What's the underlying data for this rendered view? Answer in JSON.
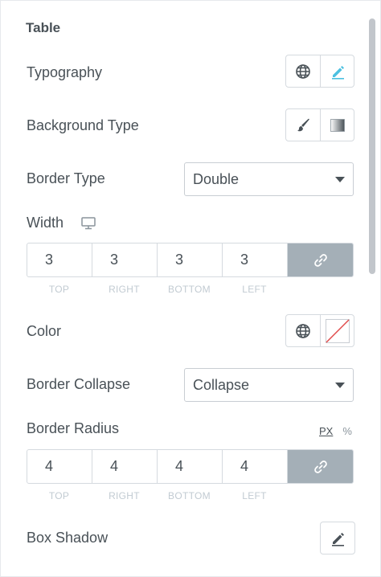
{
  "section": {
    "title": "Table"
  },
  "typography": {
    "label": "Typography",
    "icons": [
      "globe-icon",
      "pencil-icon"
    ],
    "active_color": "#4cc0e0"
  },
  "background_type": {
    "label": "Background Type",
    "icons": [
      "brush-icon",
      "gradient-icon"
    ]
  },
  "border_type": {
    "label": "Border Type",
    "value": "Double"
  },
  "width": {
    "label": "Width",
    "device_icon": "desktop-icon",
    "values": {
      "top": "3",
      "right": "3",
      "bottom": "3",
      "left": "3"
    },
    "side_labels": {
      "top": "TOP",
      "right": "RIGHT",
      "bottom": "BOTTOM",
      "left": "LEFT"
    },
    "linked": true
  },
  "color": {
    "label": "Color",
    "icons": [
      "globe-icon",
      "clear-color-swatch"
    ],
    "clear_line_color": "#e04b4b"
  },
  "border_collapse": {
    "label": "Border Collapse",
    "value": "Collapse"
  },
  "border_radius": {
    "label": "Border Radius",
    "units": {
      "px": "PX",
      "percent": "%"
    },
    "values": {
      "top": "4",
      "right": "4",
      "bottom": "4",
      "left": "4"
    },
    "side_labels": {
      "top": "TOP",
      "right": "RIGHT",
      "bottom": "BOTTOM",
      "left": "LEFT"
    },
    "linked": true
  },
  "box_shadow": {
    "label": "Box Shadow",
    "icons": [
      "pencil-icon"
    ]
  },
  "colors": {
    "link_bg": "#a4afb7",
    "text": "#495157",
    "muted": "#c2cbd2"
  }
}
